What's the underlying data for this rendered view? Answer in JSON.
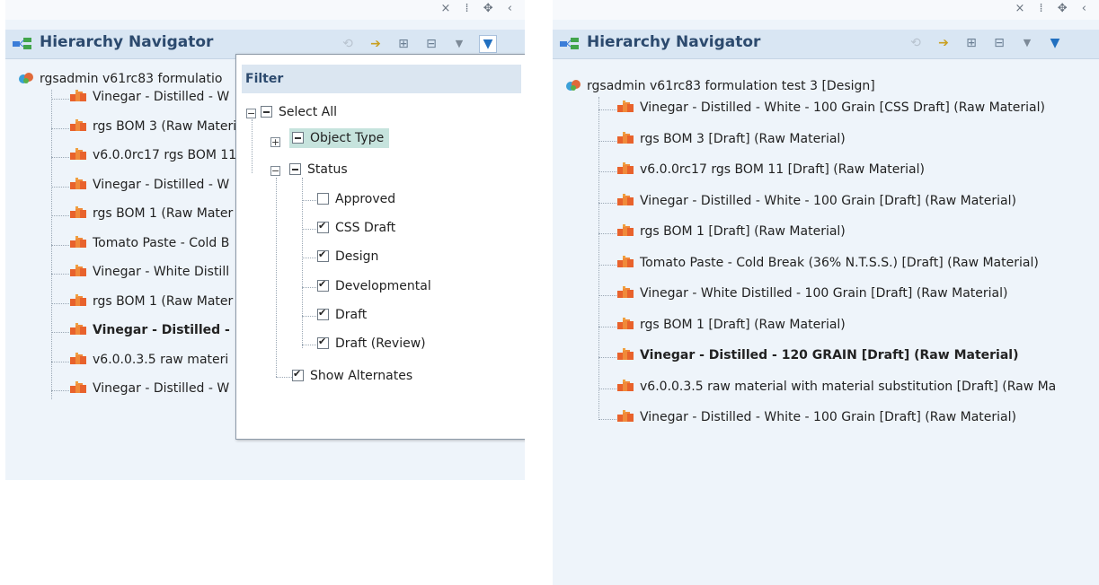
{
  "window_controls": "× ⁞ ✥ ‹",
  "panel_title": "Hierarchy Navigator",
  "icons": {
    "nav": "hierarchy-navigator-icon",
    "refresh": "refresh-icon",
    "export": "export-icon",
    "expand": "expand-all-icon",
    "collapse": "collapse-all-icon",
    "dropdown": "dropdown-arrow-icon",
    "filter": "filter-icon"
  },
  "left_tree": {
    "root": "rgsadmin v61rc83 formulatio",
    "items": [
      {
        "label": "Vinegar - Distilled - W",
        "bold": false
      },
      {
        "label": "rgs BOM 3 (Raw Materi",
        "bold": false
      },
      {
        "label": "v6.0.0rc17 rgs BOM 11",
        "bold": false
      },
      {
        "label": "Vinegar - Distilled - W",
        "bold": false
      },
      {
        "label": "rgs BOM 1 (Raw Mater",
        "bold": false
      },
      {
        "label": "Tomato Paste - Cold B",
        "bold": false
      },
      {
        "label": "Vinegar - White Distill",
        "bold": false
      },
      {
        "label": "rgs BOM 1 (Raw Mater",
        "bold": false
      },
      {
        "label": "Vinegar - Distilled -",
        "bold": true
      },
      {
        "label": "v6.0.0.3.5 raw materi",
        "bold": false
      },
      {
        "label": "Vinegar - Distilled - W",
        "bold": false
      }
    ]
  },
  "filter_popup": {
    "title": "Filter",
    "select_all": "Select All",
    "object_type": "Object Type",
    "status": "Status",
    "statuses": [
      "Approved",
      "CSS Draft",
      "Design",
      "Developmental",
      "Draft",
      "Draft (Review)"
    ],
    "status_checked": [
      false,
      true,
      true,
      true,
      true,
      true
    ],
    "show_alternates": "Show Alternates"
  },
  "right_tree": {
    "root": "rgsadmin v61rc83 formulation test 3 [Design]",
    "items": [
      {
        "label": "Vinegar - Distilled - White - 100 Grain [CSS Draft] (Raw Material)",
        "bold": false
      },
      {
        "label": "rgs BOM 3 [Draft] (Raw Material)",
        "bold": false
      },
      {
        "label": "v6.0.0rc17 rgs BOM 11 [Draft] (Raw Material)",
        "bold": false
      },
      {
        "label": "Vinegar - Distilled - White - 100 Grain [Draft] (Raw Material)",
        "bold": false
      },
      {
        "label": "rgs BOM 1 [Draft] (Raw Material)",
        "bold": false
      },
      {
        "label": "Tomato Paste - Cold Break (36% N.T.S.S.) [Draft] (Raw Material)",
        "bold": false
      },
      {
        "label": "Vinegar - White Distilled - 100 Grain [Draft] (Raw Material)",
        "bold": false
      },
      {
        "label": "rgs BOM 1 [Draft] (Raw Material)",
        "bold": false
      },
      {
        "label": "Vinegar - Distilled - 120 GRAIN [Draft] (Raw Material)",
        "bold": true
      },
      {
        "label": "v6.0.0.3.5 raw material with material substitution [Draft] (Raw Ma",
        "bold": false
      },
      {
        "label": "Vinegar - Distilled - White - 100 Grain [Draft] (Raw Material)",
        "bold": false
      }
    ]
  }
}
